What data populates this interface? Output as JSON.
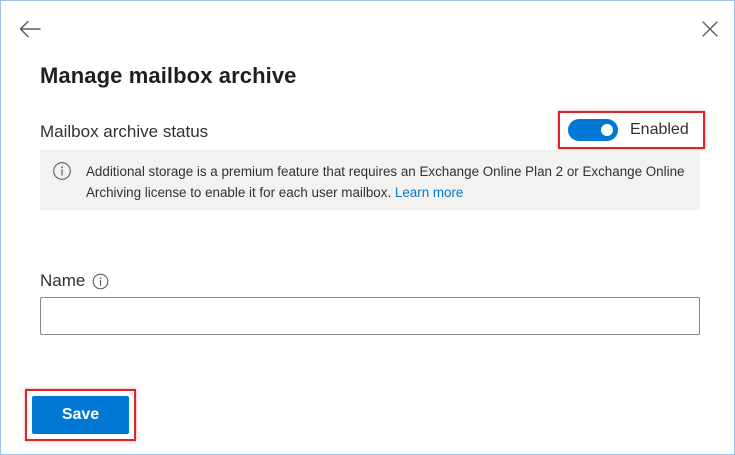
{
  "header": {
    "back_icon": "arrow-left-icon",
    "close_icon": "close-icon",
    "title": "Manage mailbox archive"
  },
  "archive_status": {
    "label": "Mailbox archive status",
    "toggle_on": true,
    "toggle_text": "Enabled",
    "toggle_color": "#0078d4"
  },
  "info": {
    "icon": "info-icon",
    "text": "Additional storage is a premium feature that requires an Exchange Online Plan 2 or Exchange Online Archiving license to enable it for each user mailbox.",
    "link_text": "Learn more"
  },
  "name_field": {
    "label": "Name",
    "icon": "info-icon",
    "value": "",
    "placeholder": ""
  },
  "footer": {
    "save_label": "Save",
    "accent": "#0078d4"
  },
  "highlight_color": "#d9262b"
}
